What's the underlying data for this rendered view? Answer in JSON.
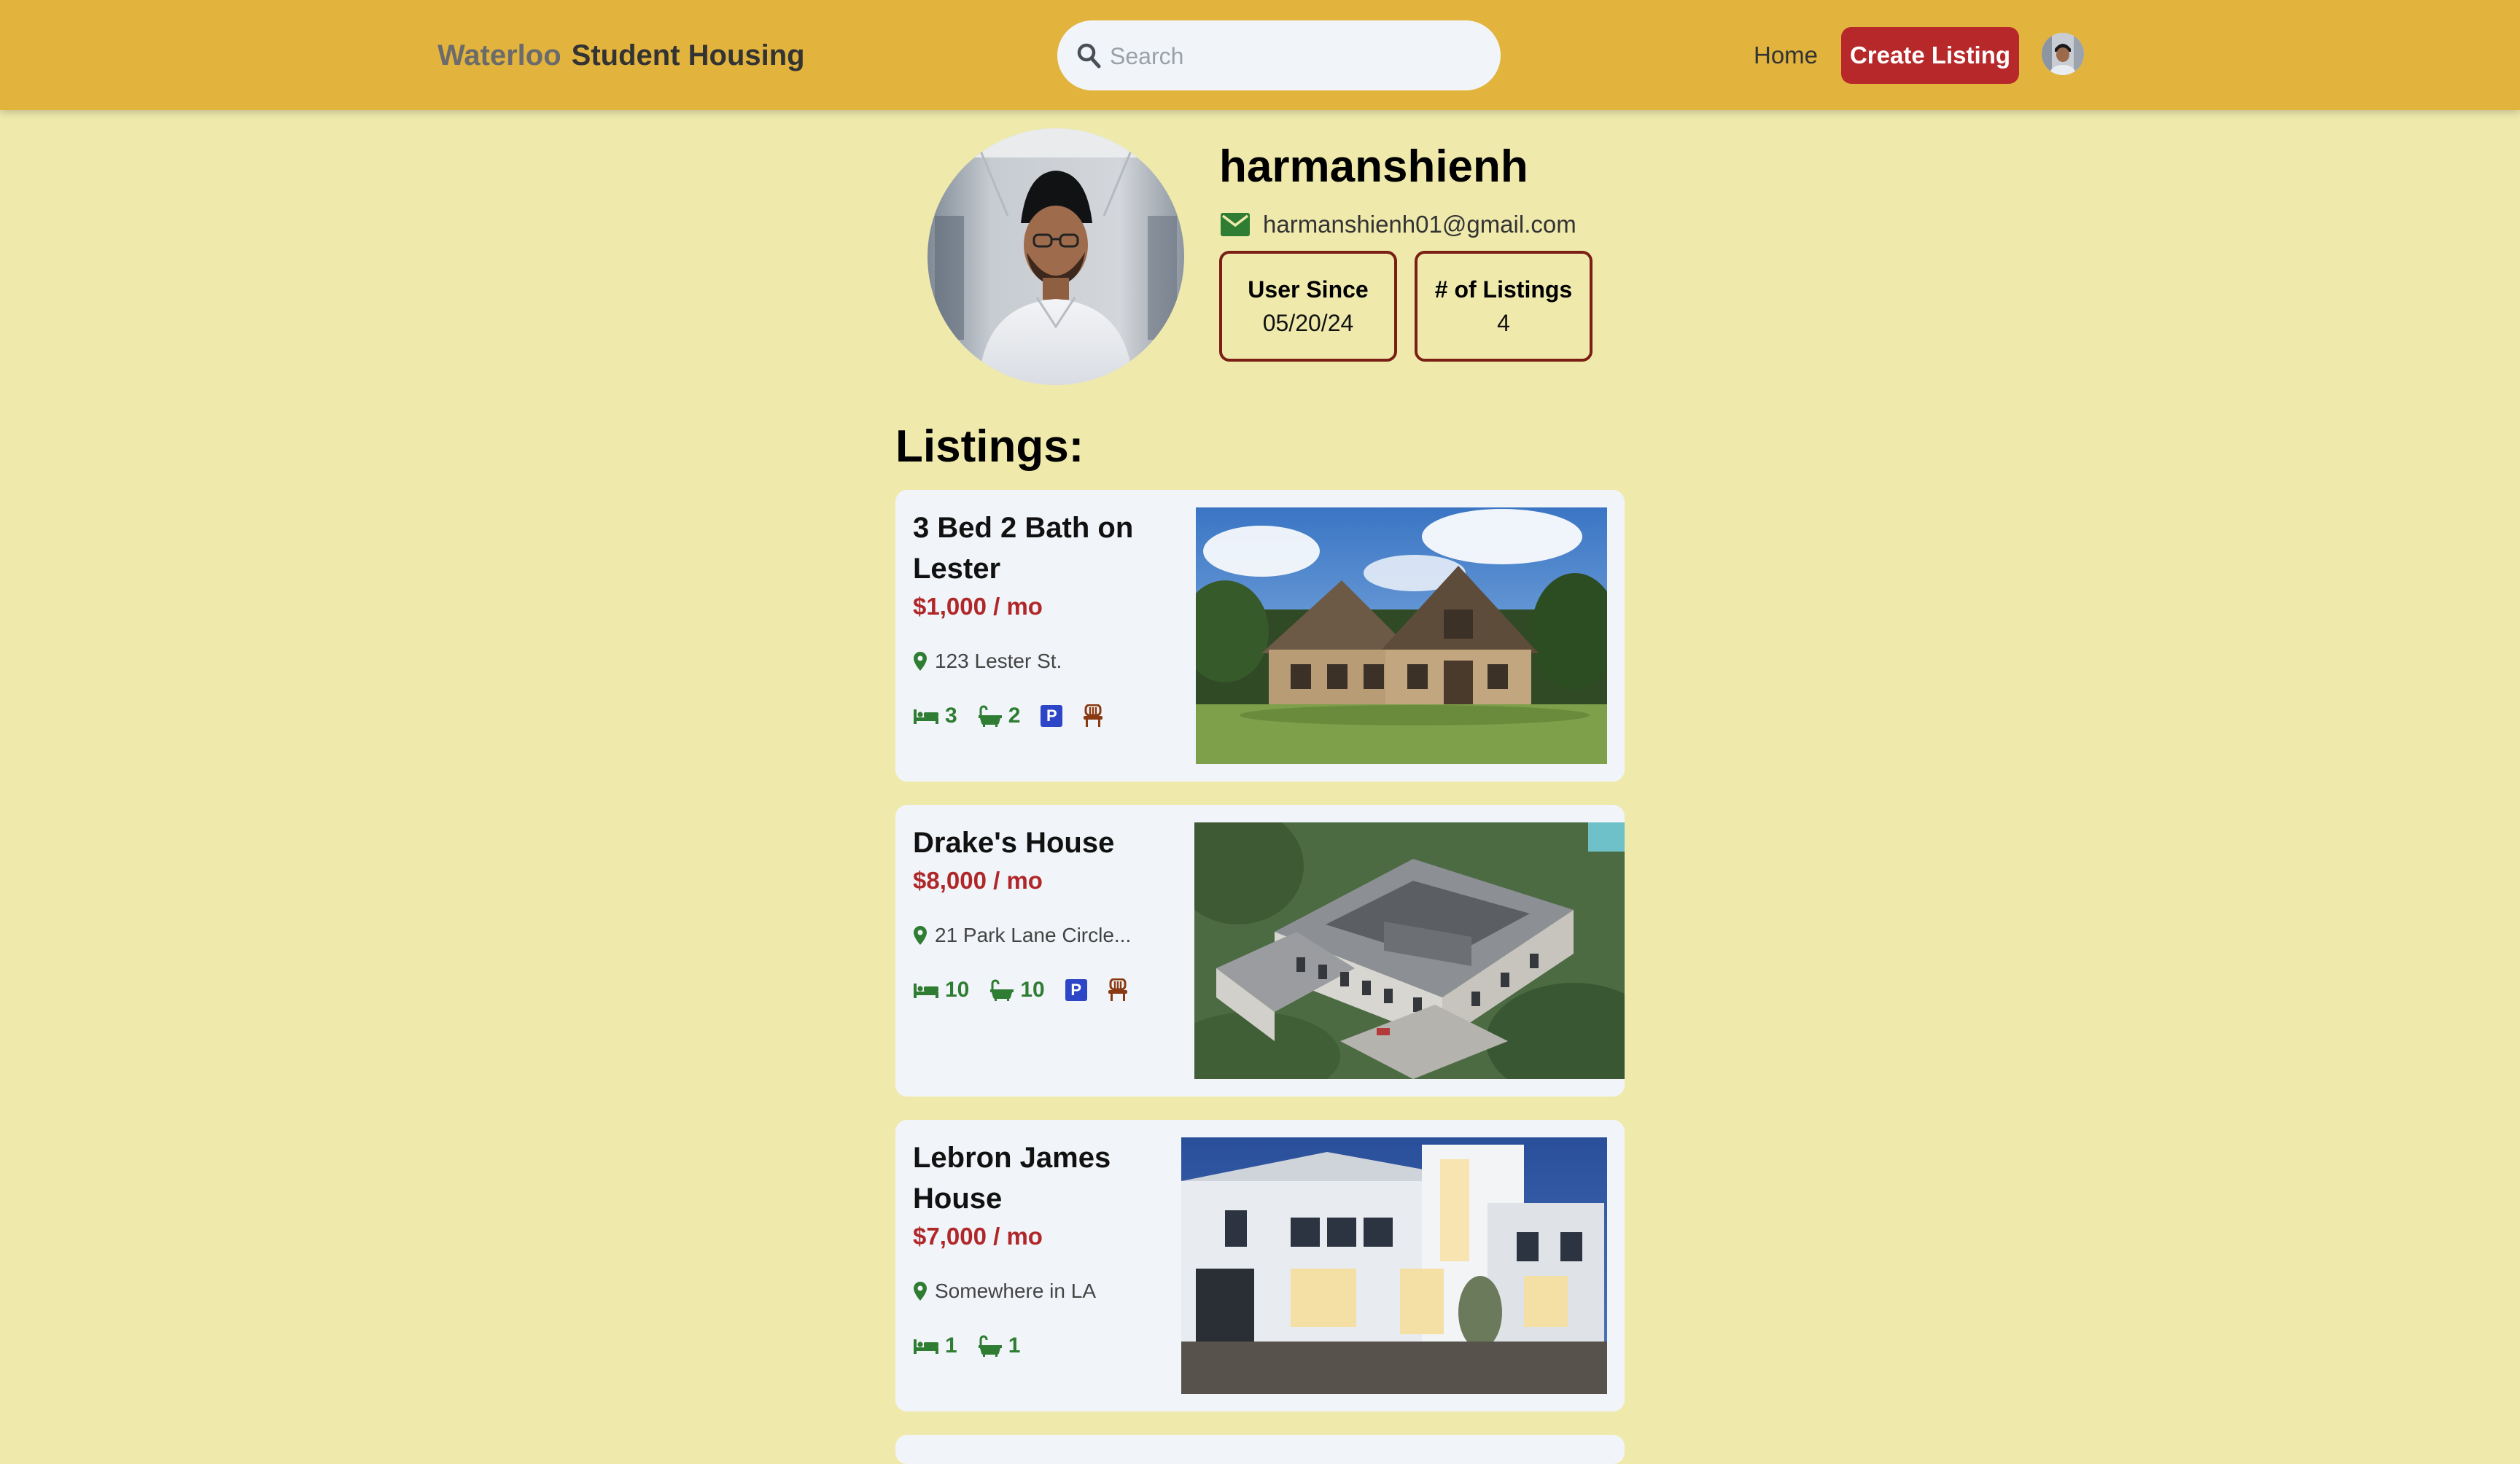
{
  "navbar": {
    "brand_part1": "Waterloo",
    "brand_part2": "Student Housing",
    "search_placeholder": "Search",
    "home_label": "Home",
    "create_label": "Create Listing",
    "avatar_icon": "user-avatar"
  },
  "profile": {
    "username": "harmanshienh",
    "email": "harmanshienh01@gmail.com",
    "email_icon": "mail-icon",
    "stats": [
      {
        "label": "User Since",
        "value": "05/20/24"
      },
      {
        "label": "# of Listings",
        "value": "4"
      }
    ]
  },
  "listings_heading": "Listings:",
  "listings": [
    {
      "title": "3 Bed 2 Bath on Lester",
      "price": "$1,000 / mo",
      "address": "123 Lester St.",
      "beds": "3",
      "baths": "2",
      "parking": true,
      "furnished": true
    },
    {
      "title": "Drake's House",
      "price": "$8,000 / mo",
      "address": "21 Park Lane Circle...",
      "beds": "10",
      "baths": "10",
      "parking": true,
      "furnished": true
    },
    {
      "title": "Lebron James House",
      "price": "$7,000 / mo",
      "address": "Somewhere in LA",
      "beds": "1",
      "baths": "1",
      "parking": false,
      "furnished": false
    }
  ],
  "colors": {
    "navbar_bg": "#e2b43d",
    "page_bg": "#efeaac",
    "accent_red": "#b7282a",
    "price_red": "#b0272a",
    "icon_green": "#2e7d32",
    "parking_blue": "#2d46c7",
    "card_bg": "#f1f4f8"
  }
}
